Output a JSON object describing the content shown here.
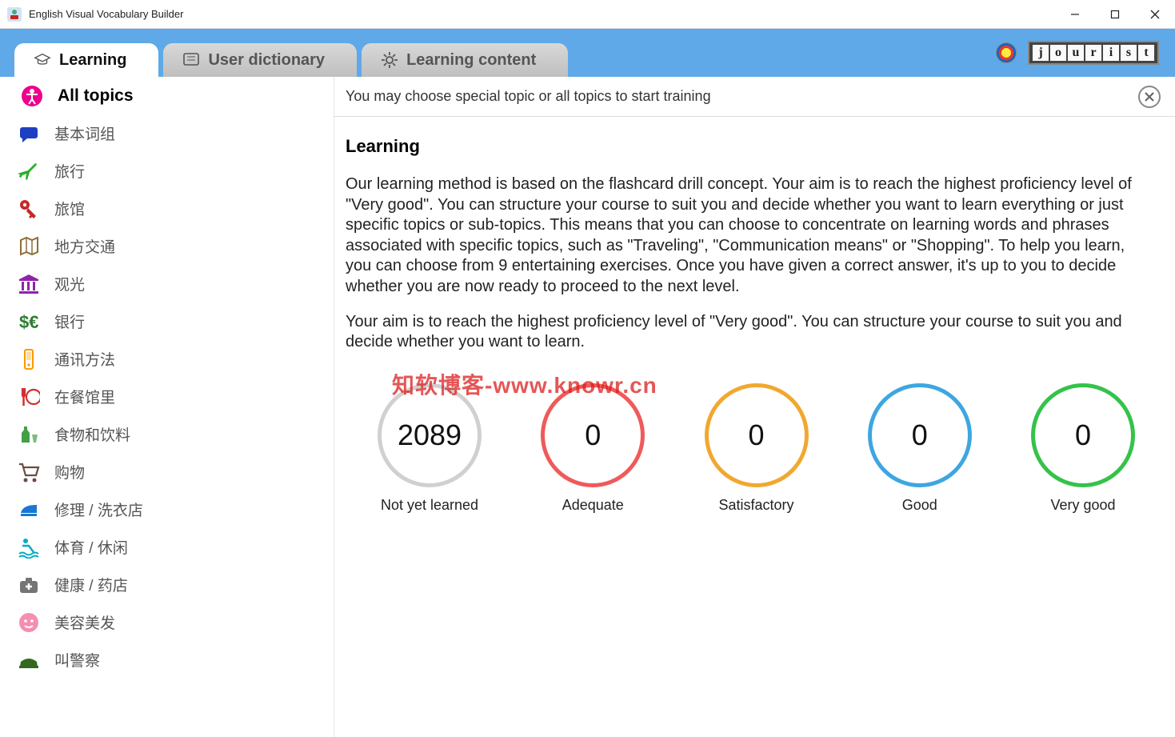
{
  "window": {
    "title": "English Visual Vocabulary Builder"
  },
  "tabs": {
    "learning": "Learning",
    "dictionary": "User dictionary",
    "content": "Learning content"
  },
  "logo_letters": [
    "j",
    "o",
    "u",
    "r",
    "i",
    "s",
    "t"
  ],
  "sidebar": {
    "items": [
      {
        "label": "All topics",
        "icon": "accessibility",
        "color": "#ec008c"
      },
      {
        "label": "基本词组",
        "icon": "speech",
        "color": "#1e3fbf"
      },
      {
        "label": "旅行",
        "icon": "plane",
        "color": "#2bae2b"
      },
      {
        "label": "旅馆",
        "icon": "key",
        "color": "#c62828"
      },
      {
        "label": "地方交通",
        "icon": "map",
        "color": "#8d6e36"
      },
      {
        "label": "观光",
        "icon": "columns",
        "color": "#8e24aa"
      },
      {
        "label": "银行",
        "icon": "dollar",
        "color": "#2e7d32"
      },
      {
        "label": "通讯方法",
        "icon": "phone",
        "color": "#ff9800"
      },
      {
        "label": "在餐馆里",
        "icon": "cutlery",
        "color": "#d32f2f"
      },
      {
        "label": "食物和饮料",
        "icon": "bottle",
        "color": "#43a047"
      },
      {
        "label": "购物",
        "icon": "cart",
        "color": "#6d4c41"
      },
      {
        "label": "修理 / 洗衣店",
        "icon": "iron",
        "color": "#1976d2"
      },
      {
        "label": "体育 / 休闲",
        "icon": "pool",
        "color": "#00acc1"
      },
      {
        "label": "健康 / 药店",
        "icon": "medkit",
        "color": "#757575"
      },
      {
        "label": "美容美发",
        "icon": "face",
        "color": "#f48fb1"
      },
      {
        "label": "叫警察",
        "icon": "police",
        "color": "#33691e"
      }
    ]
  },
  "main": {
    "instruction": "You may choose special topic or all topics to start training",
    "heading": "Learning",
    "para1": "Our learning method is based on the flashcard drill concept. Your aim is to reach the highest proficiency level of \"Very good\". You can structure your course to suit you and decide whether you want to learn everything or just specific topics or sub-topics. This means that you can choose to concentrate on learning words and phrases associated with specific topics, such as \"Traveling\", \"Communication means\" or \"Shopping\". To help you learn, you can choose from 9 entertaining exercises. Once you have given a correct answer, it's up to you to decide whether you are now ready to proceed to the next level.",
    "para2": "Your aim is to reach the highest proficiency level of \"Very good\". You can structure your course to suit you and decide whether you want to learn.",
    "stats": [
      {
        "value": "2089",
        "label": "Not yet learned",
        "color": "#d0d0d0"
      },
      {
        "value": "0",
        "label": "Adequate",
        "color": "#ef5a5a"
      },
      {
        "value": "0",
        "label": "Satisfactory",
        "color": "#f0a830"
      },
      {
        "value": "0",
        "label": "Good",
        "color": "#3ea6e0"
      },
      {
        "value": "0",
        "label": "Very good",
        "color": "#35c24a"
      }
    ]
  },
  "watermark": "知软博客-www.knowr.cn"
}
